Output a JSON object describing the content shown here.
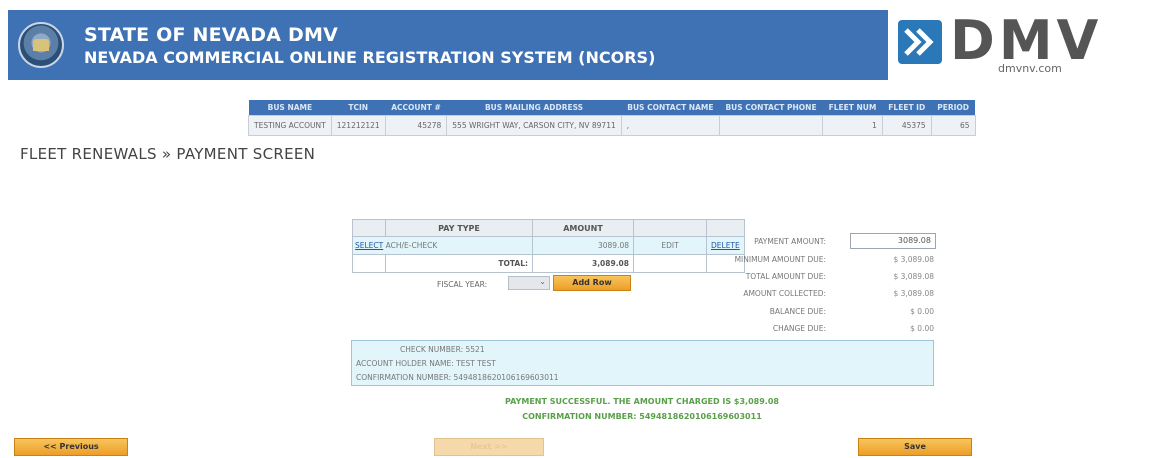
{
  "header": {
    "title": "STATE OF NEVADA DMV",
    "subtitle": "NEVADA COMMERCIAL ONLINE REGISTRATION SYSTEM (NCORS)",
    "logo_text": "DMV",
    "logo_url": "dmvnv.com"
  },
  "account_table": {
    "headers": [
      "BUS NAME",
      "TCIN",
      "ACCOUNT #",
      "BUS MAILING ADDRESS",
      "BUS CONTACT NAME",
      "BUS CONTACT PHONE",
      "FLEET NUM",
      "FLEET ID",
      "PERIOD"
    ],
    "row": [
      "TESTING ACCOUNT",
      "121212121",
      "45278",
      "555 WRIGHT WAY, CARSON CITY, NV 89711",
      ",",
      "",
      "1",
      "45375",
      "65"
    ]
  },
  "breadcrumb": "FLEET RENEWALS » PAYMENT SCREEN",
  "pay_grid": {
    "headers": [
      "",
      "PAY TYPE",
      "AMOUNT",
      "",
      ""
    ],
    "row": {
      "select": "SELECT",
      "pay_type": "ACH/E-CHECK",
      "amount": "3089.08",
      "edit": "EDIT",
      "delete": "DELETE"
    },
    "total_label": "TOTAL:",
    "total_value": "3,089.08"
  },
  "fiscal": {
    "label": "FISCAL YEAR:",
    "selected": "",
    "add_row_label": "Add Row"
  },
  "summary": {
    "payment_amount_label": "PAYMENT AMOUNT:",
    "payment_amount_value": "3089.08",
    "minimum_due_label": "MINIMUM AMOUNT DUE:",
    "minimum_due_value": "$ 3,089.08",
    "total_due_label": "TOTAL AMOUNT DUE:",
    "total_due_value": "$ 3,089.08",
    "collected_label": "AMOUNT COLLECTED:",
    "collected_value": "$ 3,089.08",
    "balance_label": "BALANCE DUE:",
    "balance_value": "$ 0.00",
    "change_label": "CHANGE DUE:",
    "change_value": "$ 0.00"
  },
  "check_info": {
    "check_number": "CHECK NUMBER: 5521",
    "holder_name": "ACCOUNT HOLDER NAME: TEST TEST",
    "confirmation": "CONFIRMATION NUMBER: 5494818620106169603011"
  },
  "success": {
    "line1": "PAYMENT SUCCESSFUL. THE AMOUNT CHARGED IS $3,089.08",
    "line2": "CONFIRMATION NUMBER: 5494818620106169603011"
  },
  "footer": {
    "previous_label": "<< Previous",
    "next_label": "Next >>",
    "save_label": "Save"
  },
  "colors": {
    "header_blue": "#3e72b4",
    "button_orange": "#ed9e28",
    "row_highlight": "#e1f5fb",
    "success_green": "#5aa04a"
  }
}
